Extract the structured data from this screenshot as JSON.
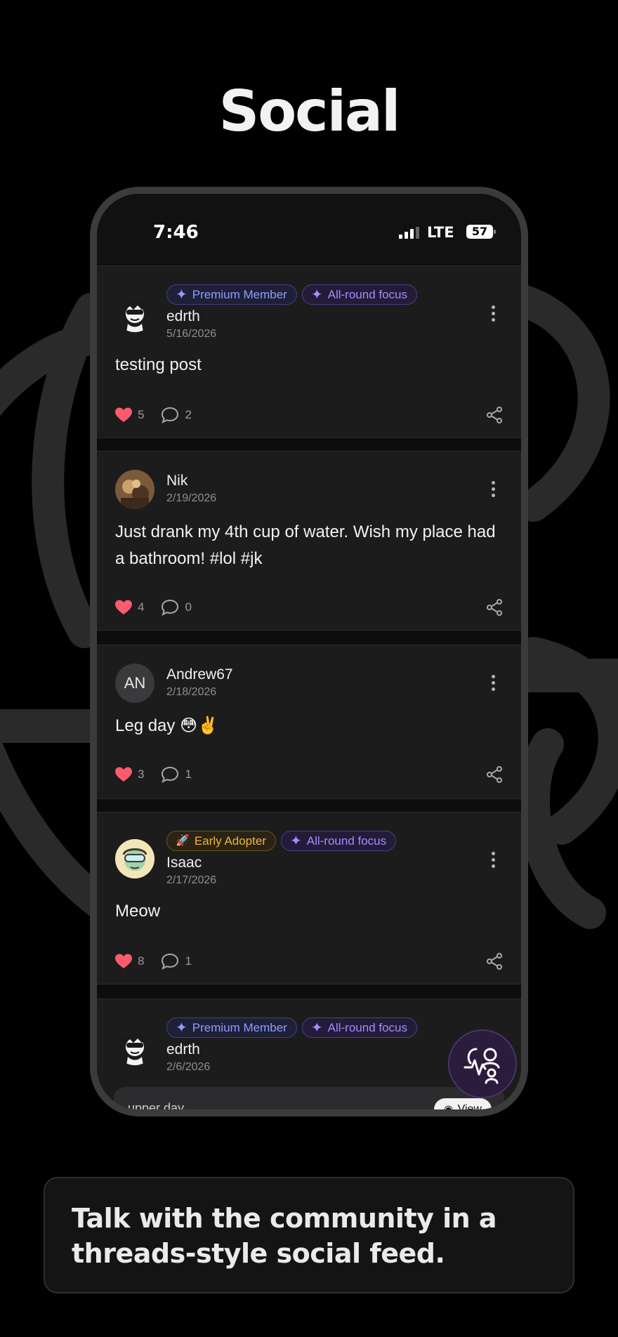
{
  "hero": {
    "title": "Social"
  },
  "status_bar": {
    "time": "7:46",
    "network": "LTE",
    "battery": "57"
  },
  "posts": [
    {
      "username": "edrth",
      "date": "5/16/2026",
      "content": "testing post",
      "badges": [
        {
          "label": "Premium Member",
          "kind": "premium"
        },
        {
          "label": "All-round focus",
          "kind": "focus"
        }
      ],
      "likes": "5",
      "comments": "2"
    },
    {
      "username": "Nik",
      "date": "2/19/2026",
      "content": "Just drank my 4th cup of water. Wish my place had a bathroom! #lol #jk",
      "badges": [],
      "likes": "4",
      "comments": "0"
    },
    {
      "username": "Andrew67",
      "initials": "AN",
      "date": "2/18/2026",
      "content": "Leg day 😳✌️",
      "badges": [],
      "likes": "3",
      "comments": "1"
    },
    {
      "username": "Isaac",
      "date": "2/17/2026",
      "content": "Meow",
      "badges": [
        {
          "label": "Early Adopter",
          "kind": "early"
        },
        {
          "label": "All-round focus",
          "kind": "focus"
        }
      ],
      "likes": "8",
      "comments": "1"
    },
    {
      "username": "edrth",
      "date": "2/6/2026",
      "badges": [
        {
          "label": "Premium Member",
          "kind": "premium"
        },
        {
          "label": "All-round focus",
          "kind": "focus"
        }
      ],
      "media_text": "upper day",
      "media_button": "View"
    }
  ],
  "caption": {
    "text": "Talk with the community in a threads-style social feed."
  },
  "colors": {
    "like": "#ff5a6e",
    "premium": "#8d9cff",
    "focus": "#a48cff",
    "early": "#f0b33b",
    "fab": "#2b1c3e"
  },
  "icons": [
    "heart-icon",
    "comment-icon",
    "share-icon",
    "more-icon",
    "sparkle-icon",
    "rocket-icon",
    "fab-icon"
  ]
}
